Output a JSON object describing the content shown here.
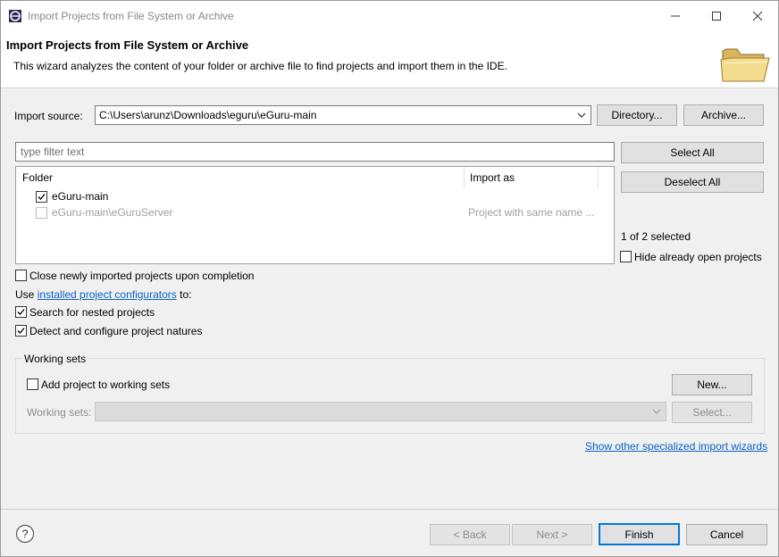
{
  "window": {
    "title": "Import Projects from File System or Archive",
    "controls": [
      "minimize",
      "maximize",
      "close"
    ]
  },
  "header": {
    "title": "Import Projects from File System or Archive",
    "description": "This wizard analyzes the content of your folder or archive file to find projects and import them in the IDE.",
    "icon": "folder-icon"
  },
  "import_source": {
    "label": "Import source:",
    "value": "C:\\Users\\arunz\\Downloads\\eguru\\eGuru-main",
    "directory_button": "Directory...",
    "archive_button": "Archive..."
  },
  "filter": {
    "placeholder": "type filter text"
  },
  "table": {
    "columns": [
      "Folder",
      "Import as"
    ],
    "rows": [
      {
        "folder": "eGuru-main",
        "import_as": "",
        "checked": true,
        "enabled": true
      },
      {
        "folder": "eGuru-main\\eGuruServer",
        "import_as": "Project with same name ...",
        "checked": false,
        "enabled": false
      }
    ]
  },
  "side": {
    "select_all": "Select All",
    "deselect_all": "Deselect All",
    "selection_count": "1 of 2 selected",
    "hide_open_label": "Hide already open projects",
    "hide_open_checked": false
  },
  "options": {
    "close_projects_label": "Close newly imported projects upon completion",
    "close_projects_checked": false,
    "use_prefix": "Use",
    "configurators_link": "installed project configurators",
    "use_suffix": "to:",
    "nested_label": "Search for nested projects",
    "nested_checked": true,
    "natures_label": "Detect and configure project natures",
    "natures_checked": true
  },
  "working_sets": {
    "group_title": "Working sets",
    "add_label": "Add project to working sets",
    "add_checked": false,
    "new_button": "New...",
    "sets_label": "Working sets:",
    "sets_value": "",
    "select_button": "Select..."
  },
  "other_wizards_link": "Show other specialized import wizards",
  "footer": {
    "back": "< Back",
    "next": "Next >",
    "finish": "Finish",
    "cancel": "Cancel"
  },
  "colors": {
    "accent": "#0078d7",
    "link": "#0b62c4",
    "dialog_bg": "#f0f0f0"
  }
}
